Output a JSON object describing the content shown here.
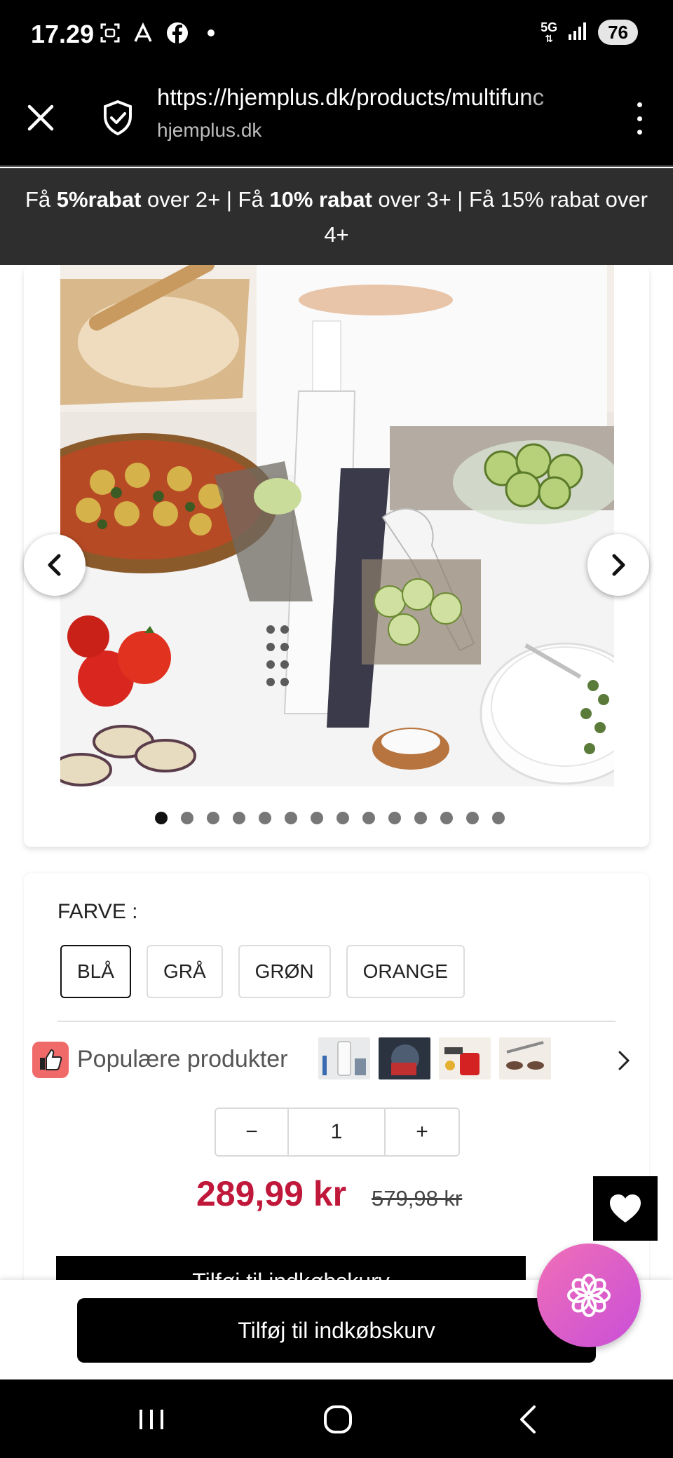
{
  "status_bar": {
    "time": "17.29",
    "network": "5G",
    "battery": "76",
    "icons": [
      "screenshot-icon",
      "signal-app-icon",
      "facebook-icon",
      "notification-dot-icon",
      "cell-signal-icon"
    ]
  },
  "browser": {
    "url": "https://hjemplus.dk/products/multifunc",
    "host": "hjemplus.dk"
  },
  "promo": {
    "p1": "Få ",
    "b1": "5%rabat",
    "p2": " over 2+ | Få ",
    "b2": "10% rabat",
    "p3": " over 3+ | Få 15% rabat over 4+"
  },
  "gallery": {
    "slide_count": 14,
    "active_index": 0
  },
  "options": {
    "color_label": "FARVE :",
    "colors": [
      "BLÅ",
      "GRÅ",
      "GRØN",
      "ORANGE"
    ],
    "selected_color": "BLÅ"
  },
  "popular": {
    "label": "Populære produkter"
  },
  "quantity": {
    "minus": "−",
    "value": "1",
    "plus": "+"
  },
  "price": {
    "current": "289,99 kr",
    "compare": "579,98 kr"
  },
  "cart": {
    "inline_label": "Tilføj til indkøbskurv",
    "sticky_label": "Tilføj til indkøbskurv"
  },
  "colors": {
    "price_red": "#c0183a",
    "promo_bg": "#2e2e2e",
    "flower_gradient_start": "#f06fb6",
    "flower_gradient_end": "#c94fd8"
  }
}
